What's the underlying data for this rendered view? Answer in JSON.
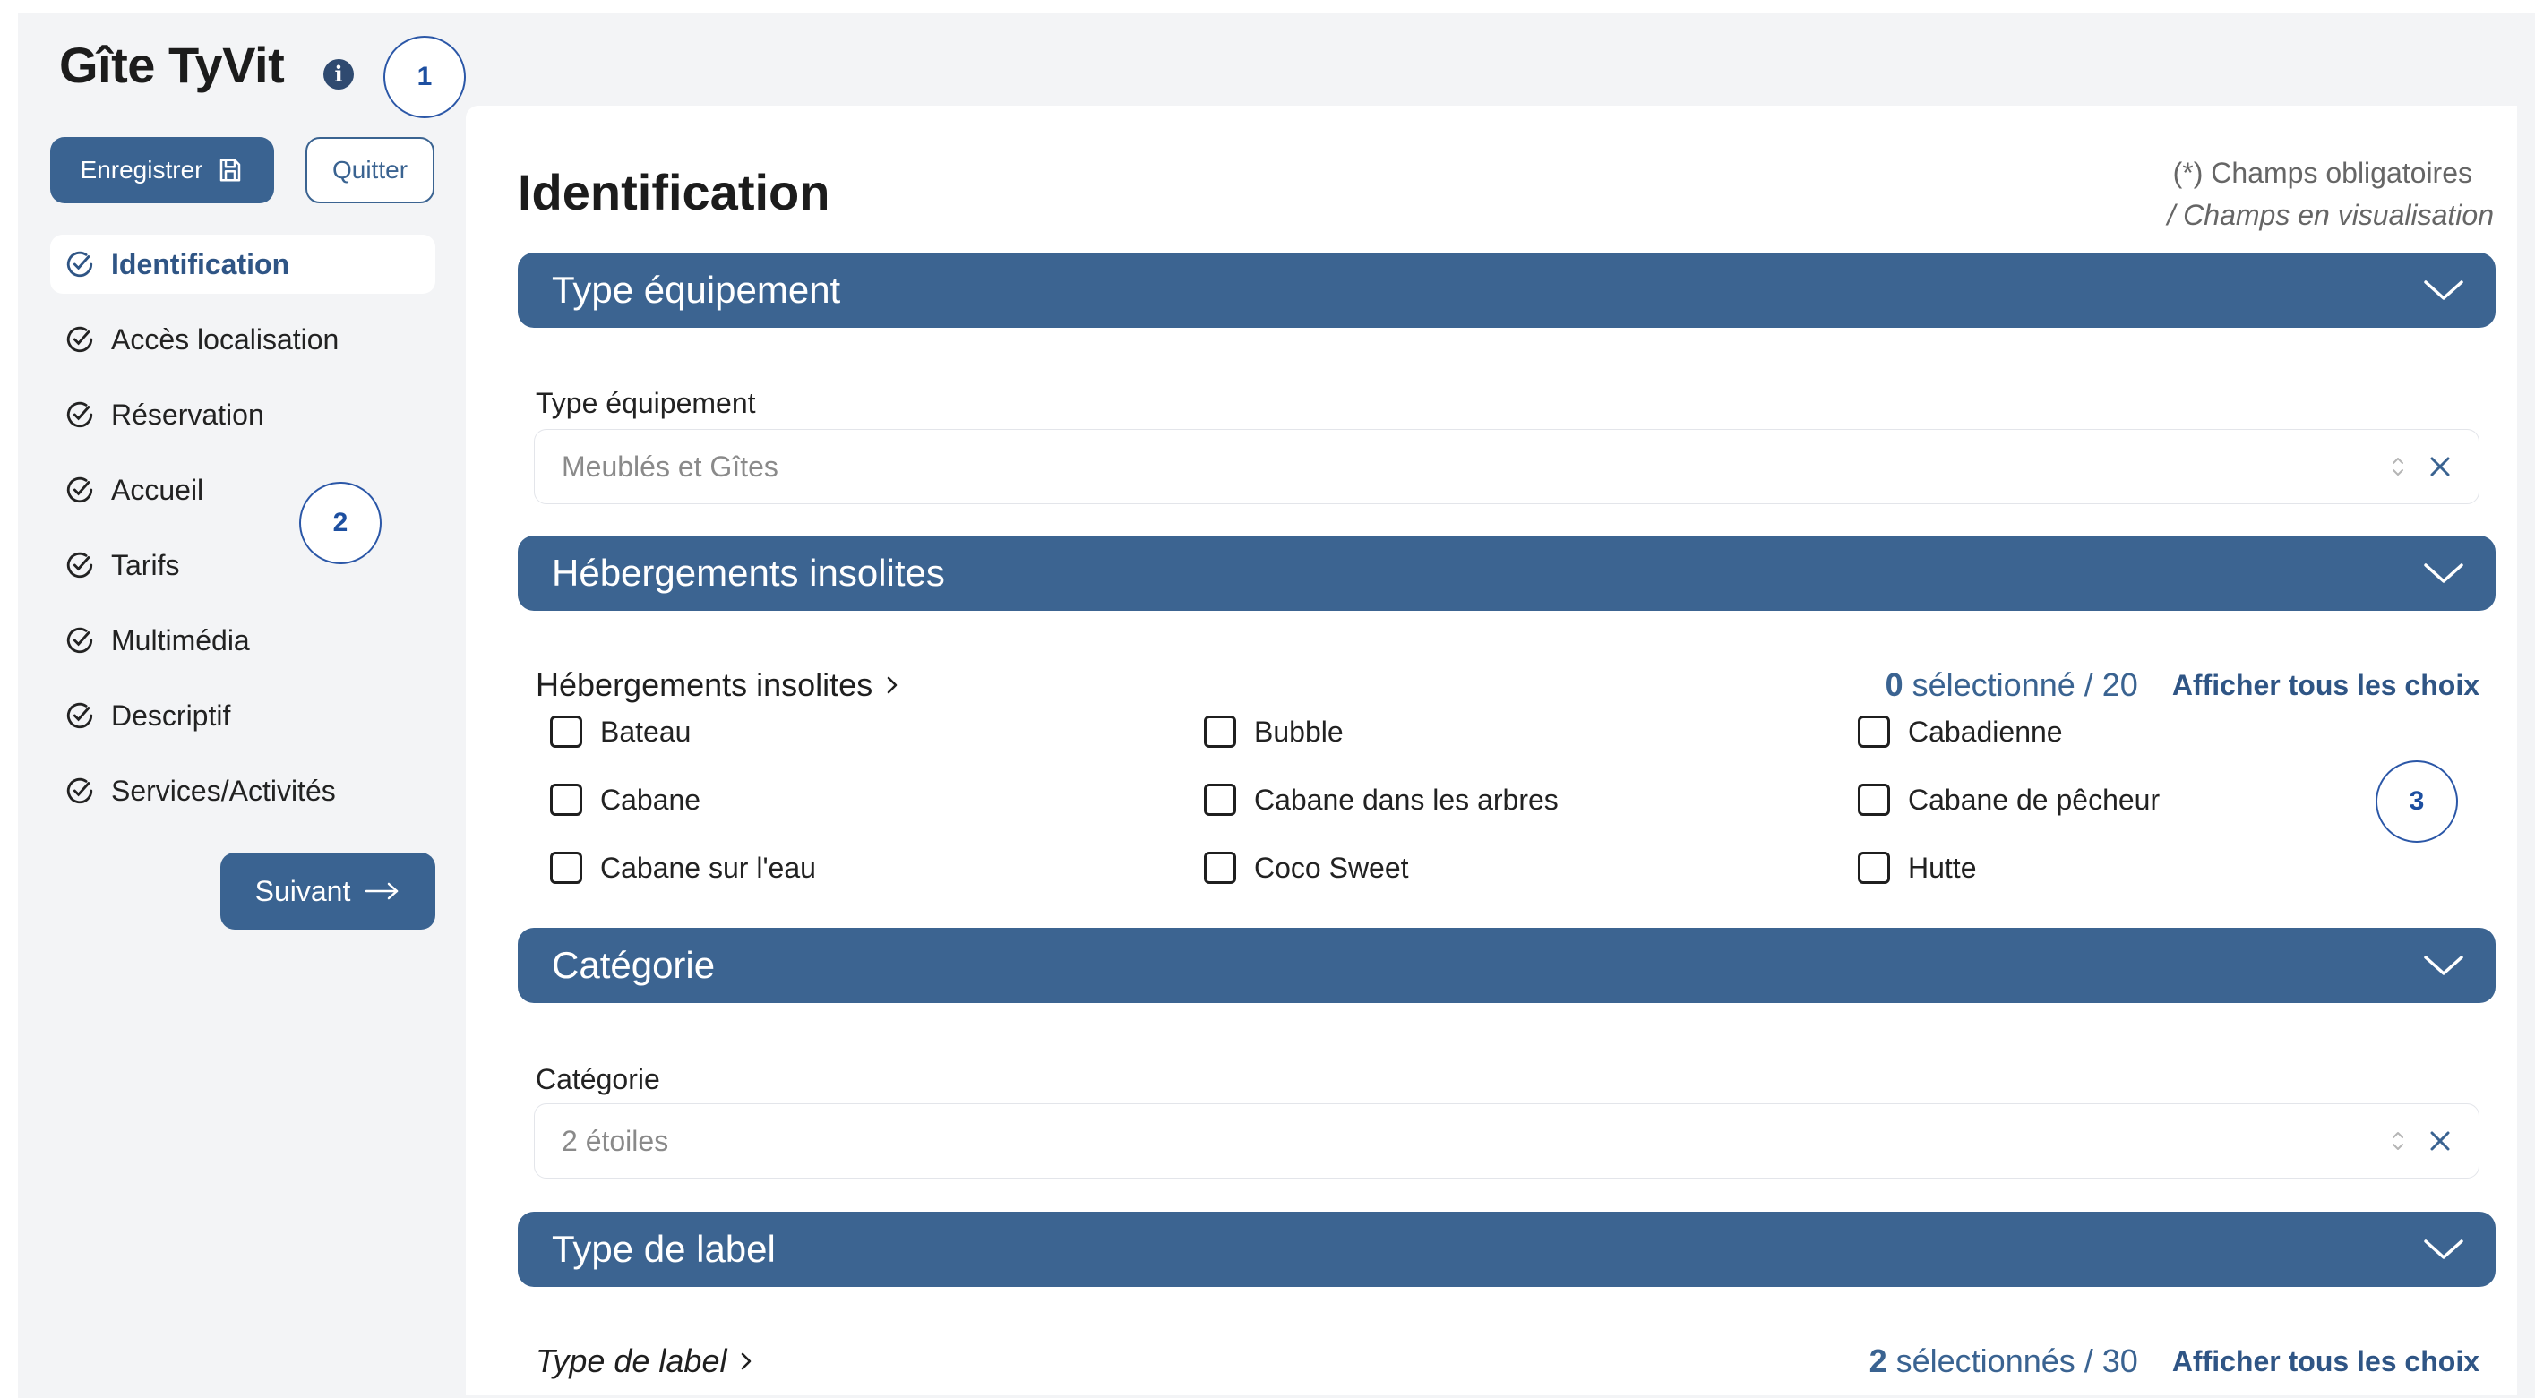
{
  "app": {
    "title": "Gîte TyVit"
  },
  "callouts": [
    "1",
    "2",
    "3"
  ],
  "toolbar": {
    "save_label": "Enregistrer",
    "quit_label": "Quitter",
    "next_label": "Suivant"
  },
  "sidebar": {
    "items": [
      {
        "label": "Identification",
        "active": true
      },
      {
        "label": "Accès localisation",
        "active": false
      },
      {
        "label": "Réservation",
        "active": false
      },
      {
        "label": "Accueil",
        "active": false
      },
      {
        "label": "Tarifs",
        "active": false
      },
      {
        "label": "Multimédia",
        "active": false
      },
      {
        "label": "Descriptif",
        "active": false
      },
      {
        "label": "Services/Activités",
        "active": false
      }
    ]
  },
  "main": {
    "title": "Identification",
    "legend_required": "(*) Champs obligatoires",
    "legend_view": "/ Champs en visualisation",
    "sections": {
      "type_equipement": {
        "header": "Type équipement",
        "field_label": "Type équipement",
        "value": "Meublés et Gîtes"
      },
      "hebergements": {
        "header": "Hébergements insolites",
        "group_label": "Hébergements insolites",
        "selected_count": "0",
        "selected_text": "sélectionné / 20",
        "show_all": "Afficher tous les choix",
        "options": [
          "Bateau",
          "Bubble",
          "Cabadienne",
          "Cabane",
          "Cabane dans les arbres",
          "Cabane de pêcheur",
          "Cabane sur l'eau",
          "Coco Sweet",
          "Hutte"
        ]
      },
      "categorie": {
        "header": "Catégorie",
        "field_label": "Catégorie",
        "value": "2 étoiles"
      },
      "type_label": {
        "header": "Type de label",
        "group_label": "Type de label",
        "selected_count": "2",
        "selected_text": "sélectionnés / 30",
        "show_all": "Afficher tous les choix"
      }
    }
  },
  "colors": {
    "primary": "#3a6391",
    "section_bar": "#3c6491",
    "background": "#f3f4f6",
    "callout": "#2b57a7"
  }
}
